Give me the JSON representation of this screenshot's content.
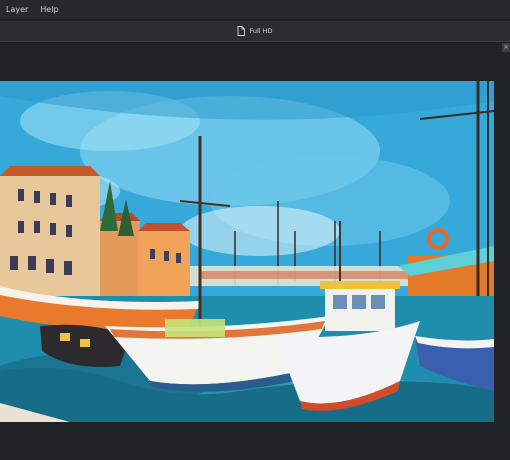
{
  "menubar": {
    "items": [
      {
        "label": "Layer"
      },
      {
        "label": "Help"
      }
    ]
  },
  "document": {
    "tab_label": "Full HD",
    "close_symbol": "×"
  },
  "canvas": {
    "image_description_icon": "image-icon",
    "palette": {
      "sky": "#35aee0",
      "sky_light": "#8fd9f3",
      "water": "#1d7f9e",
      "orange": "#e9792c",
      "white": "#f3f3ee",
      "dark": "#2f2a2a"
    }
  }
}
